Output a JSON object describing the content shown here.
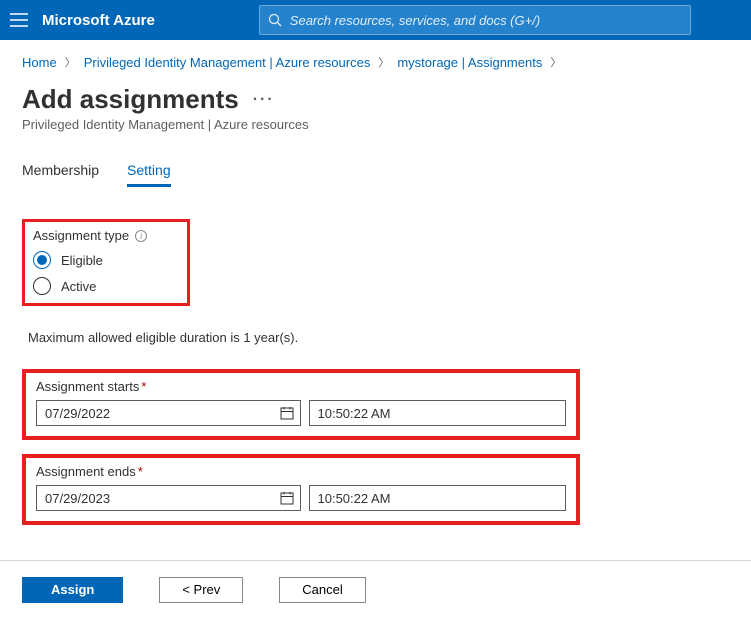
{
  "header": {
    "brand": "Microsoft Azure",
    "search_placeholder": "Search resources, services, and docs (G+/)"
  },
  "breadcrumbs": {
    "items": [
      "Home",
      "Privileged Identity Management | Azure resources",
      "mystorage | Assignments"
    ]
  },
  "page": {
    "title": "Add assignments",
    "subtitle": "Privileged Identity Management | Azure resources"
  },
  "tabs": [
    "Membership",
    "Setting"
  ],
  "active_tab": "Setting",
  "assignment_type": {
    "label": "Assignment type",
    "options": [
      "Eligible",
      "Active"
    ],
    "selected": "Eligible"
  },
  "max_note": "Maximum allowed eligible duration is 1 year(s).",
  "starts": {
    "label": "Assignment starts",
    "date": "07/29/2022",
    "time": "10:50:22 AM"
  },
  "ends": {
    "label": "Assignment ends",
    "date": "07/29/2023",
    "time": "10:50:22 AM"
  },
  "footer": {
    "assign": "Assign",
    "prev": "<  Prev",
    "cancel": "Cancel"
  }
}
